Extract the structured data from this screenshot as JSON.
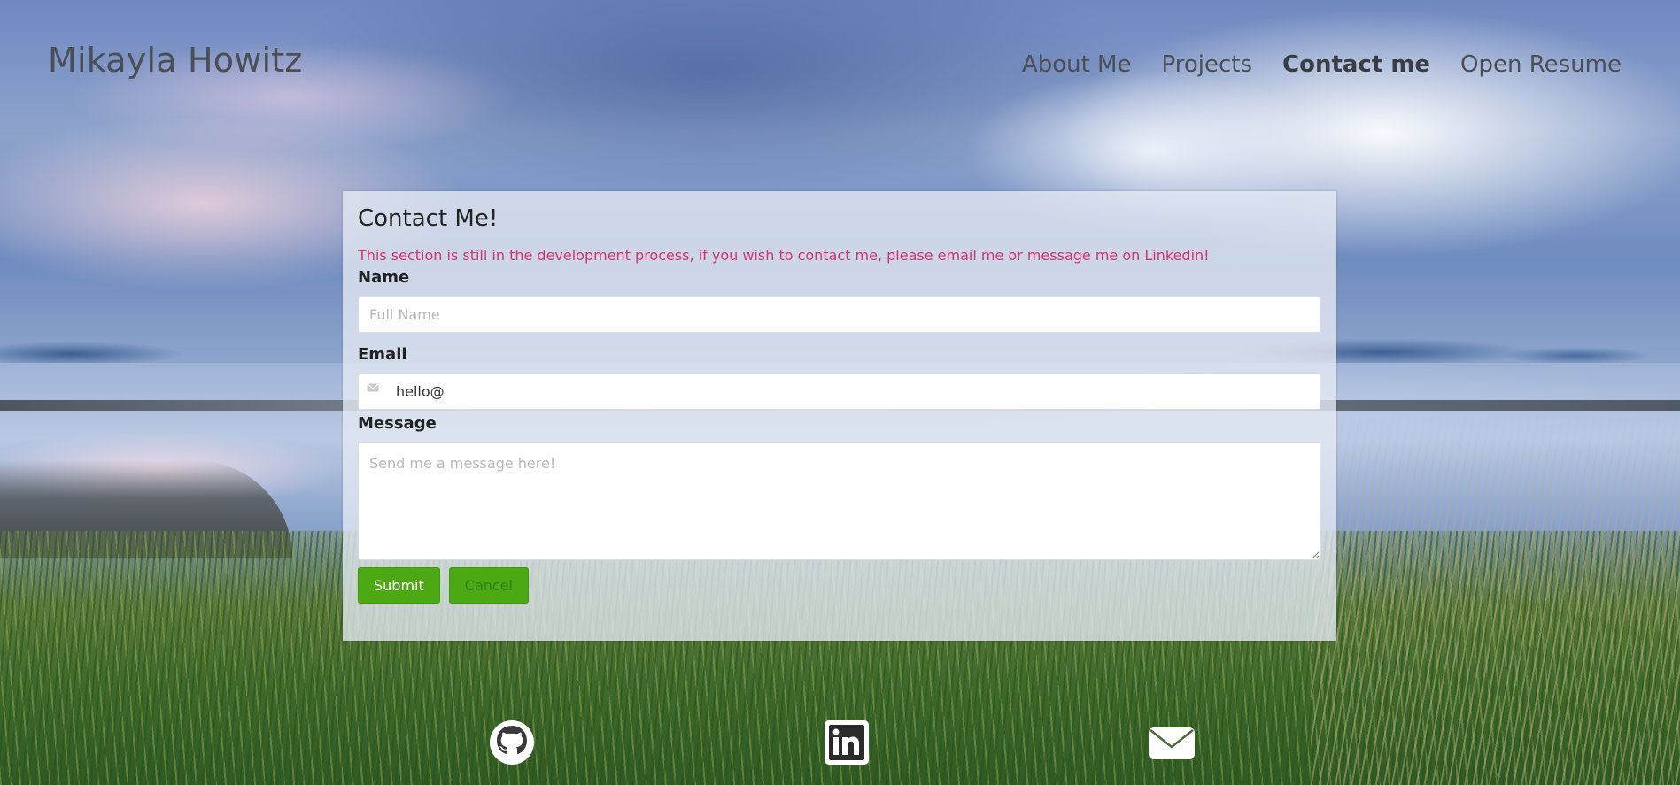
{
  "header": {
    "site_title": "Mikayla Howitz",
    "nav": [
      {
        "label": "About Me",
        "active": false
      },
      {
        "label": "Projects",
        "active": false
      },
      {
        "label": "Contact me",
        "active": true
      },
      {
        "label": "Open Resume",
        "active": false
      }
    ]
  },
  "contact": {
    "title": "Contact Me!",
    "notice": "This section is still in the development process, if you wish to contact me, please email me or message me on Linkedin!",
    "name_label": "Name",
    "name_placeholder": "Full Name",
    "name_value": "",
    "email_label": "Email",
    "email_value": "hello@",
    "email_icon": "envelope-icon",
    "message_label": "Message",
    "message_placeholder": "Send me a message here!",
    "submit_label": "Submit",
    "cancel_label": "Cancel"
  },
  "footer": {
    "social_icons": [
      "github-icon",
      "linkedin-icon",
      "mail-icon"
    ]
  },
  "colors": {
    "notice": "#d6336c",
    "button_green": "#4ca813",
    "text_dark": "#4b4f55"
  }
}
